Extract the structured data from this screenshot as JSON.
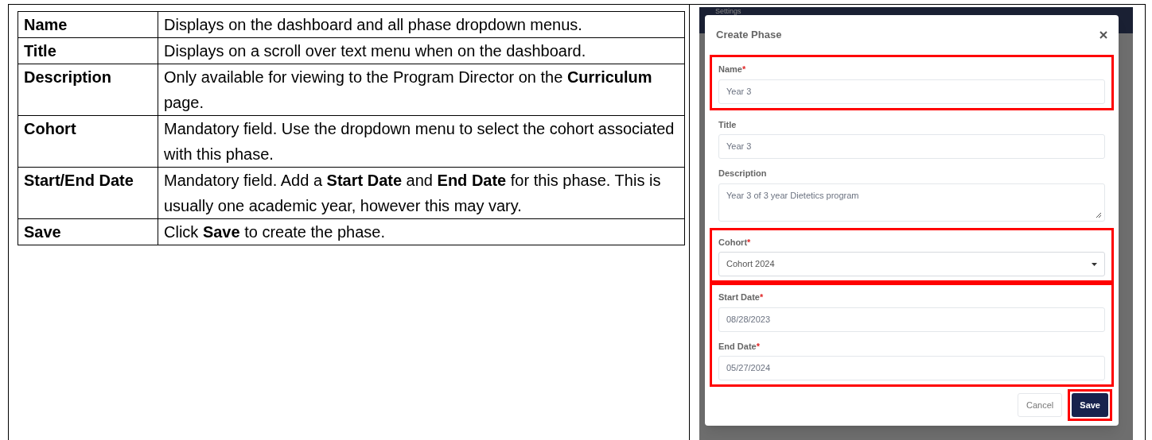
{
  "table": {
    "rows": [
      {
        "term": "Name",
        "description": "Displays on the dashboard and all phase dropdown menus."
      },
      {
        "term": "Title",
        "description": "Displays on a scroll over text menu when on the dashboard."
      },
      {
        "term": "Description",
        "description": "Only available for viewing to the Program Director on the **Curriculum** page."
      },
      {
        "term": "Cohort",
        "description": "Mandatory field. Use the dropdown menu to select the cohort associated with this phase."
      },
      {
        "term": "Start/End Date",
        "description": "Mandatory field. Add a **Start Date** and **End Date** for this phase. This is usually one academic year, however this may vary."
      },
      {
        "term": "Save",
        "description": "Click **Save** to create the phase."
      }
    ]
  },
  "screenshot": {
    "header": "Settings",
    "dialog": {
      "title": "Create Phase",
      "groups": [
        {
          "highlighted": true,
          "fields": [
            {
              "label": "Name",
              "required_marker": "*",
              "value": "Year 3",
              "kind": "text"
            }
          ]
        },
        {
          "highlighted": false,
          "fields": [
            {
              "label": "Title",
              "value": "Year 3",
              "kind": "text"
            },
            {
              "label": "Description",
              "value": "Year 3 of 3 year Dietetics program",
              "kind": "textarea"
            }
          ]
        },
        {
          "highlighted": true,
          "fields": [
            {
              "label": "Cohort",
              "required_marker": "*",
              "value": "Cohort 2024",
              "kind": "select"
            }
          ]
        },
        {
          "highlighted": true,
          "fields": [
            {
              "label": "Start Date",
              "required_marker": "*",
              "value": "08/28/2023",
              "kind": "text"
            },
            {
              "label": "End Date",
              "required_marker": "*",
              "value": "05/27/2024",
              "kind": "text"
            }
          ]
        }
      ],
      "buttons": [
        {
          "label": "Cancel",
          "kind": "secondary",
          "highlighted": false
        },
        {
          "label": "Save",
          "kind": "primary",
          "highlighted": true
        }
      ]
    }
  }
}
